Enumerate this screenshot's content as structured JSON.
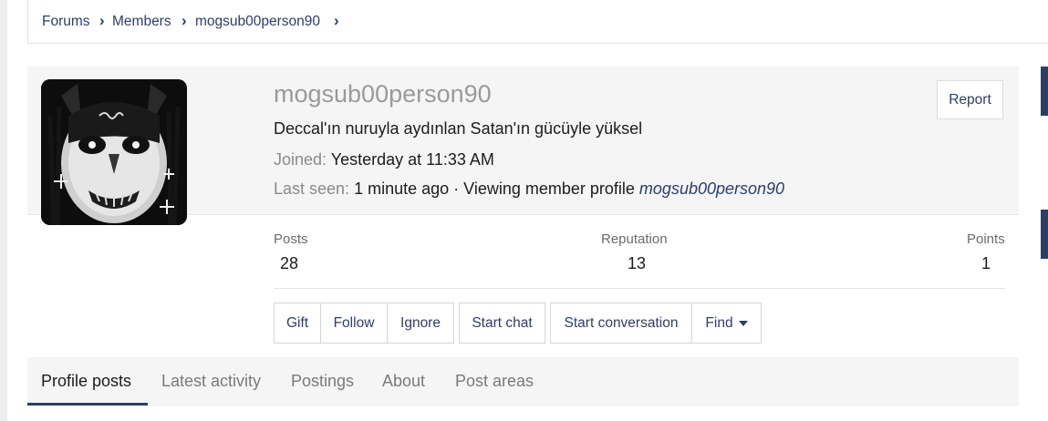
{
  "breadcrumb": [
    {
      "label": "Forums"
    },
    {
      "label": "Members"
    },
    {
      "label": "mogsub00person90"
    }
  ],
  "profile": {
    "username": "mogsub00person90",
    "custom_title": "Deccal'ın nuruyla aydınlan Satan'ın gücüyle yüksel",
    "joined_label": "Joined:",
    "joined_value": "Yesterday at 11:33 AM",
    "last_seen_label": "Last seen:",
    "last_seen_value": "1 minute ago · Viewing member profile",
    "last_seen_link": "mogsub00person90",
    "report_label": "Report"
  },
  "stats": [
    {
      "label": "Posts",
      "value": "28"
    },
    {
      "label": "Reputation",
      "value": "13"
    },
    {
      "label": "Points",
      "value": "1"
    }
  ],
  "actions": {
    "gift": "Gift",
    "follow": "Follow",
    "ignore": "Ignore",
    "start_chat": "Start chat",
    "start_conversation": "Start conversation",
    "find": "Find"
  },
  "tabs": [
    {
      "label": "Profile posts",
      "active": true
    },
    {
      "label": "Latest activity"
    },
    {
      "label": "Postings"
    },
    {
      "label": "About"
    },
    {
      "label": "Post areas"
    }
  ],
  "colors": {
    "accent": "#2b3e6b",
    "panel": "#f5f5f5"
  }
}
